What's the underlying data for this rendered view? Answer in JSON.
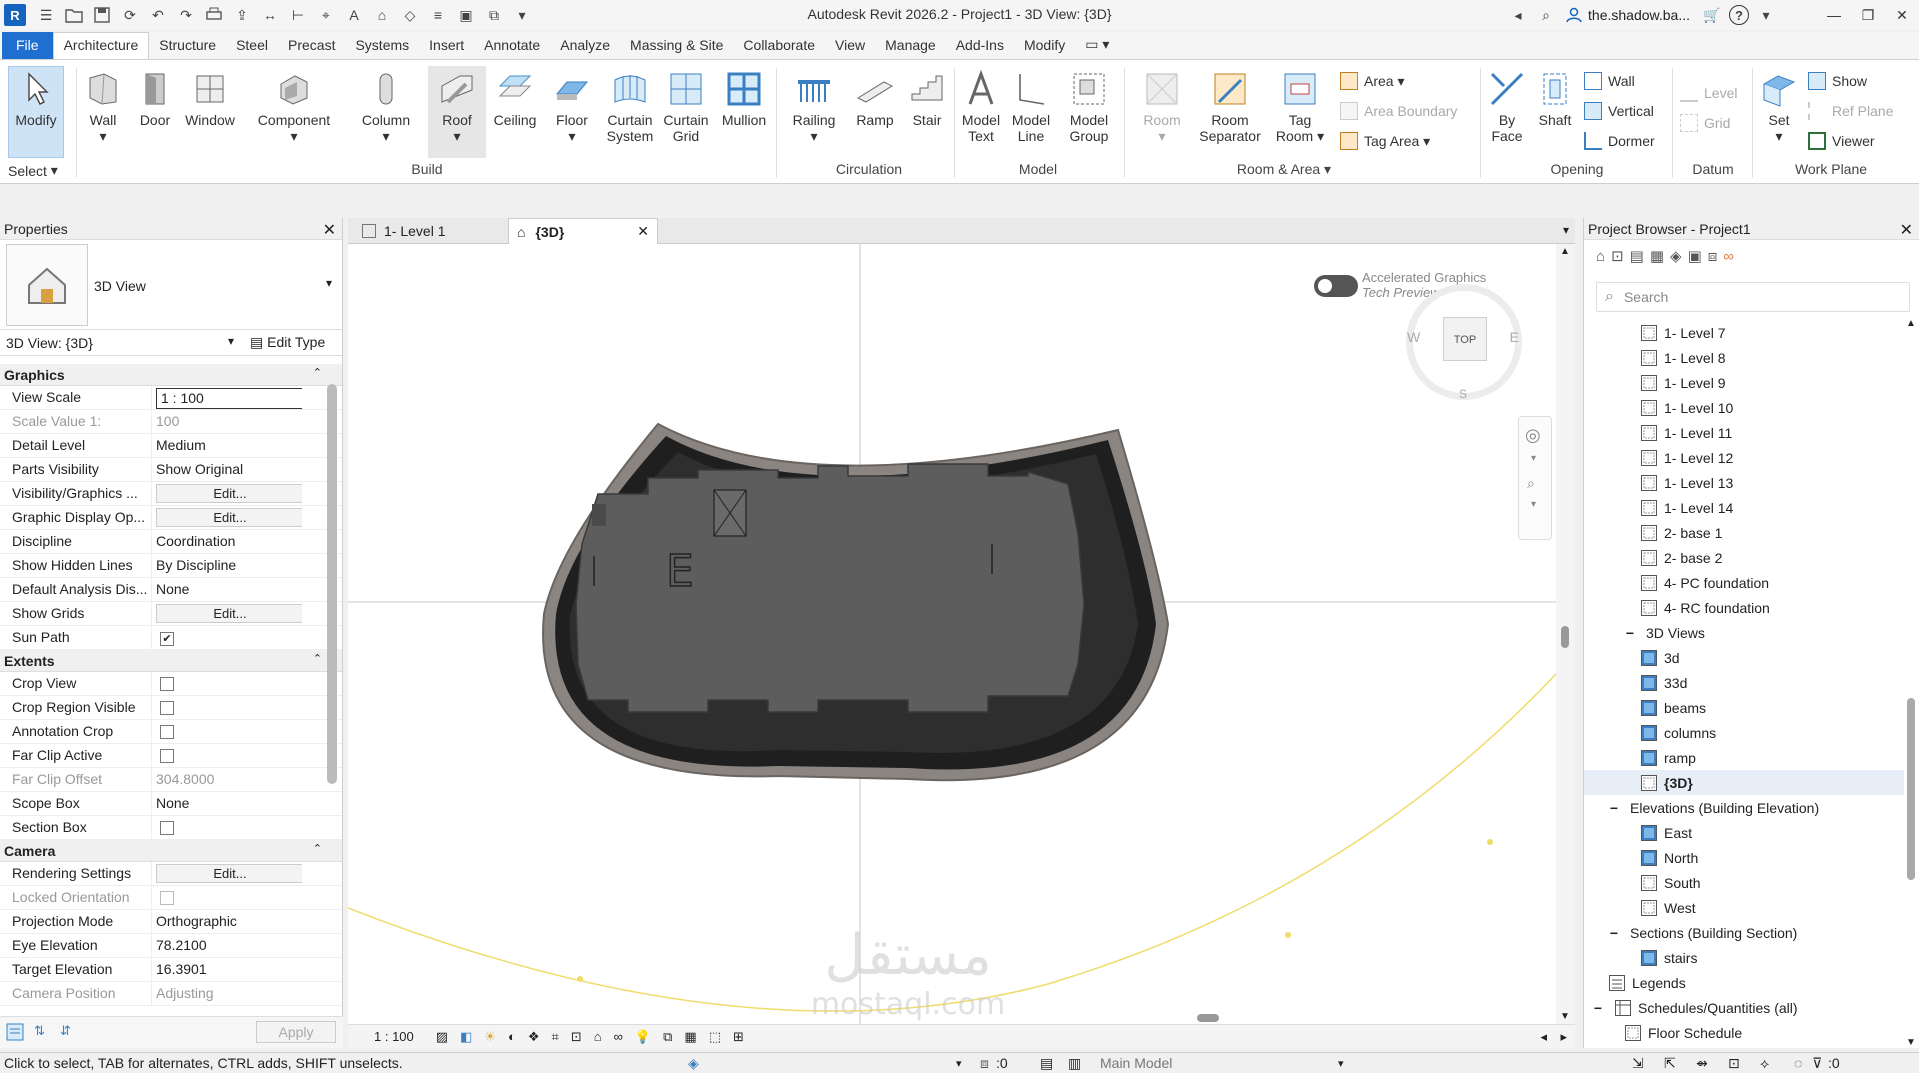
{
  "app": {
    "logo_letter": "R",
    "title": "Autodesk Revit 2026.2 - Project1 - 3D View: {3D}",
    "user": "the.shadow.ba...",
    "help": "?"
  },
  "ribbon_tabs": [
    "File",
    "Architecture",
    "Structure",
    "Steel",
    "Precast",
    "Systems",
    "Insert",
    "Annotate",
    "Analyze",
    "Massing & Site",
    "Collaborate",
    "View",
    "Manage",
    "Add-Ins",
    "Modify"
  ],
  "active_tab": "Architecture",
  "ribbon": {
    "select": {
      "modify": "Modify",
      "label": "Select"
    },
    "build": {
      "label": "Build",
      "wall": "Wall",
      "door": "Door",
      "window": "Window",
      "component": "Component",
      "column": "Column",
      "roof": "Roof",
      "ceiling": "Ceiling",
      "floor": "Floor",
      "curtain_system_1": "Curtain",
      "curtain_system_2": "System",
      "curtain_grid_1": "Curtain",
      "curtain_grid_2": "Grid",
      "mullion": "Mullion"
    },
    "circulation": {
      "label": "Circulation",
      "railing": "Railing",
      "ramp": "Ramp",
      "stair": "Stair"
    },
    "model": {
      "label": "Model",
      "model_text_1": "Model",
      "model_text_2": "Text",
      "model_line_1": "Model",
      "model_line_2": "Line",
      "model_group_1": "Model",
      "model_group_2": "Group"
    },
    "room_area": {
      "label": "Room & Area",
      "room": "Room",
      "room_separator_1": "Room",
      "room_separator_2": "Separator",
      "tag_room_1": "Tag",
      "tag_room_2": "Room",
      "area": "Area",
      "area_boundary": "Area  Boundary",
      "tag_area": "Tag  Area"
    },
    "opening": {
      "label": "Opening",
      "by_face_1": "By",
      "by_face_2": "Face",
      "shaft": "Shaft",
      "wall": "Wall",
      "vertical": "Vertical",
      "dormer": "Dormer"
    },
    "datum": {
      "label": "Datum",
      "level": "Level",
      "grid": "Grid"
    },
    "work_plane": {
      "label": "Work Plane",
      "set": "Set",
      "show": "Show",
      "ref_plane": "Ref  Plane",
      "viewer": "Viewer"
    }
  },
  "properties": {
    "title": "Properties",
    "type_name": "3D View",
    "instance": "3D View: {3D}",
    "edit_type": "Edit Type",
    "groups": {
      "graphics": "Graphics",
      "extents": "Extents",
      "camera": "Camera"
    },
    "graphics_rows": [
      {
        "k": "View Scale",
        "v": "1 : 100"
      },
      {
        "k": "Scale Value    1:",
        "v": "100"
      },
      {
        "k": "Detail Level",
        "v": "Medium"
      },
      {
        "k": "Parts Visibility",
        "v": "Show Original"
      },
      {
        "k": "Visibility/Graphics ...",
        "v": "Edit..."
      },
      {
        "k": "Graphic Display Op...",
        "v": "Edit..."
      },
      {
        "k": "Discipline",
        "v": "Coordination"
      },
      {
        "k": "Show Hidden Lines",
        "v": "By Discipline"
      },
      {
        "k": "Default Analysis Dis...",
        "v": "None"
      },
      {
        "k": "Show Grids",
        "v": "Edit..."
      },
      {
        "k": "Sun Path",
        "v": "checked"
      }
    ],
    "extents_rows": [
      {
        "k": "Crop View",
        "v": "unchecked"
      },
      {
        "k": "Crop Region Visible",
        "v": "unchecked"
      },
      {
        "k": "Annotation Crop",
        "v": "unchecked"
      },
      {
        "k": "Far Clip Active",
        "v": "unchecked"
      },
      {
        "k": "Far Clip Offset",
        "v": "304.8000"
      },
      {
        "k": "Scope Box",
        "v": "None"
      },
      {
        "k": "Section Box",
        "v": "unchecked"
      }
    ],
    "camera_rows": [
      {
        "k": "Rendering Settings",
        "v": "Edit..."
      },
      {
        "k": "Locked Orientation",
        "v": "unchecked"
      },
      {
        "k": "Projection Mode",
        "v": "Orthographic"
      },
      {
        "k": "Eye Elevation",
        "v": "78.2100"
      },
      {
        "k": "Target Elevation",
        "v": "16.3901"
      },
      {
        "k": "Camera Position",
        "v": "Adjusting"
      }
    ],
    "apply": "Apply"
  },
  "view_tabs": [
    {
      "label": "1- Level 1",
      "active": false
    },
    {
      "label": "{3D}",
      "active": true
    }
  ],
  "viewport": {
    "accel_line1": "Accelerated Graphics",
    "accel_line2": "Tech Preview",
    "viewcube_top": "TOP",
    "compass_w": "W",
    "compass_e": "E",
    "compass_s": "S",
    "model_letter": "E",
    "watermark": "مستقل",
    "watermark_sub": "mostaql.com"
  },
  "view_status": {
    "scale": "1 : 100"
  },
  "browser": {
    "title": "Project Browser - Project1",
    "search_placeholder": "Search",
    "items": [
      {
        "label": "1- Level 7",
        "type": "plan",
        "indent": 3
      },
      {
        "label": "1- Level 8",
        "type": "plan",
        "indent": 3
      },
      {
        "label": "1- Level 9",
        "type": "plan",
        "indent": 3
      },
      {
        "label": "1- Level 10",
        "type": "plan",
        "indent": 3
      },
      {
        "label": "1- Level 11",
        "type": "plan",
        "indent": 3
      },
      {
        "label": "1- Level 12",
        "type": "plan",
        "indent": 3
      },
      {
        "label": "1- Level 13",
        "type": "plan",
        "indent": 3
      },
      {
        "label": "1- Level 14",
        "type": "plan",
        "indent": 3
      },
      {
        "label": "2- base 1",
        "type": "plan",
        "indent": 3
      },
      {
        "label": "2- base 2",
        "type": "plan",
        "indent": 3
      },
      {
        "label": "4- PC foundation",
        "type": "plan",
        "indent": 3
      },
      {
        "label": "4- RC foundation",
        "type": "plan",
        "indent": 3
      },
      {
        "label": "3D Views",
        "type": "group",
        "indent": 2
      },
      {
        "label": "3d",
        "type": "view3d",
        "indent": 3
      },
      {
        "label": "33d",
        "type": "view3d",
        "indent": 3
      },
      {
        "label": "beams",
        "type": "view3d",
        "indent": 3
      },
      {
        "label": "columns",
        "type": "view3d",
        "indent": 3
      },
      {
        "label": "ramp",
        "type": "view3d",
        "indent": 3
      },
      {
        "label": "{3D}",
        "type": "plan",
        "indent": 3,
        "selected": true
      },
      {
        "label": "Elevations (Building Elevation)",
        "type": "group",
        "indent": 1
      },
      {
        "label": "East",
        "type": "view3d",
        "indent": 3
      },
      {
        "label": "North",
        "type": "view3d",
        "indent": 3
      },
      {
        "label": "South",
        "type": "plan",
        "indent": 3
      },
      {
        "label": "West",
        "type": "plan",
        "indent": 3
      },
      {
        "label": "Sections (Building Section)",
        "type": "group",
        "indent": 1
      },
      {
        "label": "stairs",
        "type": "view3d",
        "indent": 3
      },
      {
        "label": "Legends",
        "type": "legend",
        "indent": 1
      },
      {
        "label": "Schedules/Quantities (all)",
        "type": "schedule",
        "indent": 0
      },
      {
        "label": "Floor Schedule",
        "type": "plan",
        "indent": 2
      }
    ]
  },
  "statusbar": {
    "hint": "Click to select, TAB for alternates, CTRL adds, SHIFT unselects.",
    "worksets": ":0",
    "model": "Main Model",
    "filter": ":0"
  },
  "colors": {
    "file_tab": "#1e6fd0",
    "selection": "#cfe3f7",
    "model_fill": "#555555",
    "sun_path": "#f0dc6a"
  }
}
